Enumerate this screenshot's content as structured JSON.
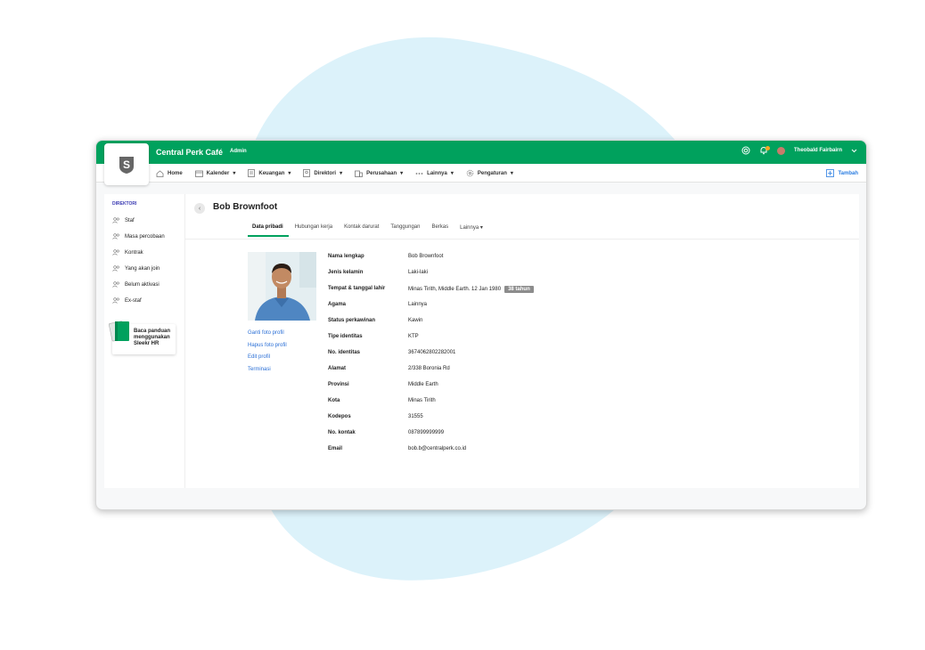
{
  "app": {
    "company": "Central Perk Café",
    "role": "Admin",
    "user": "Theobald Fairbairn",
    "logo_letter": "S",
    "accent": "#00a15d"
  },
  "nav": {
    "items": [
      {
        "label": "Home",
        "icon": "home-icon"
      },
      {
        "label": "Kalender",
        "icon": "calendar-icon"
      },
      {
        "label": "Keuangan",
        "icon": "finance-icon"
      },
      {
        "label": "Direktori",
        "icon": "directory-icon"
      },
      {
        "label": "Perusahaan",
        "icon": "building-icon"
      },
      {
        "label": "Lainnya",
        "icon": "more-icon"
      },
      {
        "label": "Pengaturan",
        "icon": "gear-icon"
      }
    ],
    "add_label": "Tambah"
  },
  "sidebar": {
    "section_title": "DIREKTORI",
    "items": [
      "Staf",
      "Masa percobaan",
      "Kontrak",
      "Yang akan join",
      "Belum aktivasi",
      "Ex-staf"
    ],
    "guide_text": "Baca panduan menggunakan Sleekr HR"
  },
  "profile": {
    "name": "Bob Brownfoot",
    "tabs": [
      "Data pribadi",
      "Hubungan kerja",
      "Kontak darurat",
      "Tanggungan",
      "Berkas",
      "Lainnya"
    ],
    "actions": [
      "Ganti foto profil",
      "Hapus foto profil",
      "Edit profil",
      "Terminasi"
    ],
    "age_badge": "38 tahun",
    "fields": [
      {
        "label": "Nama lengkap",
        "value": "Bob Brownfoot"
      },
      {
        "label": "Jenis kelamin",
        "value": "Laki-laki"
      },
      {
        "label": "Tempat & tanggal lahir",
        "value": "Minas Tirith, Middle Earth. 12 Jan 1980"
      },
      {
        "label": "Agama",
        "value": "Lainnya"
      },
      {
        "label": "Status perkawinan",
        "value": "Kawin"
      },
      {
        "label": "Tipe identitas",
        "value": "KTP"
      },
      {
        "label": "No. identitas",
        "value": "3674062802282001"
      },
      {
        "label": "Alamat",
        "value": "2/338 Boronia Rd"
      },
      {
        "label": "Provinsi",
        "value": "Middle Earth"
      },
      {
        "label": "Kota",
        "value": "Minas Tirith"
      },
      {
        "label": "Kodepos",
        "value": "31555"
      },
      {
        "label": "No. kontak",
        "value": "087899999999"
      },
      {
        "label": "Email",
        "value": "bob.b@centralperk.co.id"
      }
    ]
  }
}
